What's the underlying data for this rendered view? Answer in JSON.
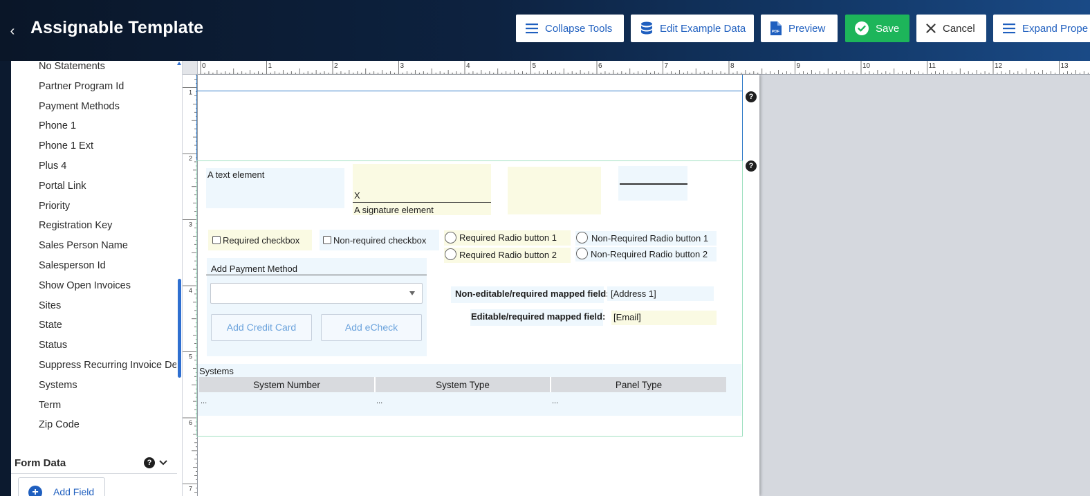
{
  "header": {
    "back_icon": "chevron-left-icon",
    "title": "Assignable Template",
    "buttons": {
      "collapse_tools": "Collapse Tools",
      "edit_example_data": "Edit Example Data",
      "preview": "Preview",
      "save": "Save",
      "cancel": "Cancel",
      "expand_properties": "Expand Prope"
    }
  },
  "sidebar": {
    "fields": [
      "No Statements",
      "Partner Program Id",
      "Payment Methods",
      "Phone 1",
      "Phone 1 Ext",
      "Plus 4",
      "Portal Link",
      "Priority",
      "Registration Key",
      "Sales Person Name",
      "Salesperson Id",
      "Show Open Invoices",
      "Sites",
      "State",
      "Status",
      "Suppress Recurring Invoice Del",
      "Systems",
      "Term",
      "Zip Code"
    ],
    "form_data_label": "Form Data",
    "help_glyph": "?",
    "add_field_label": "Add Field"
  },
  "ruler": {
    "h_labels": [
      "0",
      "1",
      "2",
      "3",
      "4",
      "5",
      "6",
      "7",
      "8",
      "9",
      "10",
      "11",
      "12",
      "13"
    ],
    "v_labels": [
      "1",
      "2",
      "3",
      "4",
      "5",
      "6",
      "7"
    ]
  },
  "template": {
    "help_glyph": "?",
    "text_element": "A text element",
    "signature_x": "X",
    "signature_label": "A signature element",
    "required_checkbox": "Required checkbox",
    "nonrequired_checkbox": "Non-required checkbox",
    "req_radio_1": "Required Radio button 1",
    "req_radio_2": "Required Radio button 2",
    "nonreq_radio_1": "Non-Required Radio button 1",
    "nonreq_radio_2": "Non-Required Radio button 2",
    "add_payment_method": "Add Payment Method",
    "add_credit_card": "Add Credit Card",
    "add_echeck": "Add eCheck",
    "nonedit_label": "Non-editable/required mapped field:",
    "nonedit_value": "[Address 1]",
    "edit_label": "Editable/required mapped field:",
    "edit_value": "[Email]",
    "systems": {
      "title": "Systems",
      "columns": [
        "System Number",
        "System Type",
        "Panel Type"
      ],
      "rows": [
        [
          "...",
          "...",
          "..."
        ]
      ]
    }
  },
  "colors": {
    "header_dark": "#0a1628",
    "accent_blue": "#1f5fbf",
    "save_green": "#1db55a",
    "field_blue_bg": "#eef7fd",
    "field_yellow_bg": "#fafae3",
    "section_green_border": "#9fe0c0"
  }
}
